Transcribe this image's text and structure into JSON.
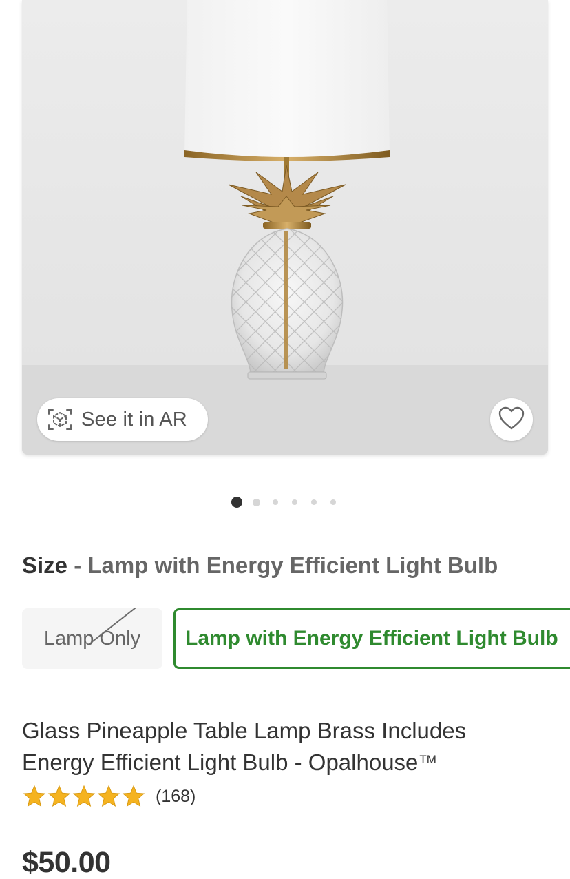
{
  "hero": {
    "ar_button_label": "See it in AR",
    "ar_icon": "ar-cube-icon",
    "favorite_icon": "heart-outline-icon",
    "image_count": 6,
    "active_image": 1
  },
  "size_selector": {
    "key": "Size",
    "separator": "-",
    "selected_value": "Lamp with Energy Efficient Light Bulb",
    "options": [
      {
        "label": "Lamp Only",
        "available": false,
        "selected": false
      },
      {
        "label": "Lamp with Energy Efficient Light Bulb",
        "available": true,
        "selected": true
      }
    ]
  },
  "product": {
    "title": "Glass Pineapple Table Lamp Brass Includes Energy Efficient Light Bulb - Opalhouse",
    "trademark": "TM",
    "rating": 5,
    "rating_max": 5,
    "review_count": "(168)",
    "price": "$50.00"
  },
  "colors": {
    "accent_green": "#2f8a2f",
    "star_gold": "#f5b320",
    "text_primary": "#333333",
    "text_secondary": "#666666"
  }
}
